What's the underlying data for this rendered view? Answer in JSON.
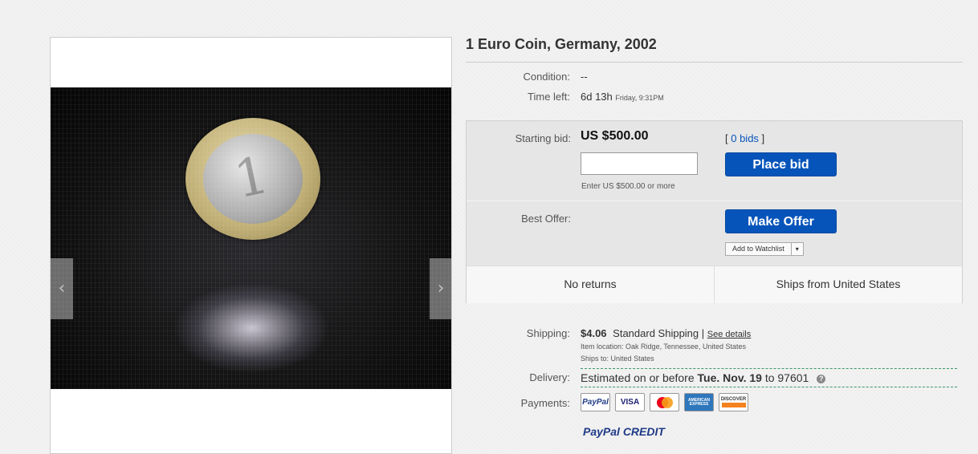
{
  "listing": {
    "title": "1 Euro Coin, Germany, 2002",
    "condition_label": "Condition:",
    "condition_value": "--",
    "time_left_label": "Time left:",
    "time_left_value": "6d 13h",
    "time_left_end": "Friday, 9:31PM"
  },
  "gallery": {
    "prev_icon": "‹",
    "next_icon": "›",
    "coin_face": "1"
  },
  "bidding": {
    "starting_bid_label": "Starting bid:",
    "starting_bid_value": "US $500.00",
    "bid_input_value": "",
    "bid_hint": "Enter US $500.00 or more",
    "bids_count_prefix": "[ ",
    "bids_count_link": "0 bids",
    "bids_count_suffix": " ]",
    "place_bid_label": "Place bid",
    "best_offer_label": "Best Offer:",
    "make_offer_label": "Make Offer",
    "watchlist_label": "Add to Watchlist",
    "watchlist_dropdown_icon": "▾",
    "returns_text": "No returns",
    "ships_from_text": "Ships from United States"
  },
  "shipping": {
    "label": "Shipping:",
    "cost": "$4.06",
    "method": "Standard Shipping",
    "separator": "|",
    "see_details": "See details",
    "item_location_label": "Item location:",
    "item_location_value": "Oak Ridge, Tennessee, United States",
    "ships_to_label": "Ships to:",
    "ships_to_value": "United States"
  },
  "delivery": {
    "label": "Delivery:",
    "text": "Estimated on or before",
    "date": "Tue. Nov. 19",
    "to": "to",
    "zip": "97601",
    "help_icon": "?"
  },
  "payments": {
    "label": "Payments:",
    "methods": [
      "PayPal",
      "VISA",
      "Mastercard",
      "AMERICAN EXPRESS",
      "DISCOVER"
    ],
    "paypal_credit": "PayPal CREDIT"
  },
  "colors": {
    "accent_blue": "#0654ba",
    "link_blue": "#0654ba",
    "dashed_green": "#3a9a6b"
  }
}
